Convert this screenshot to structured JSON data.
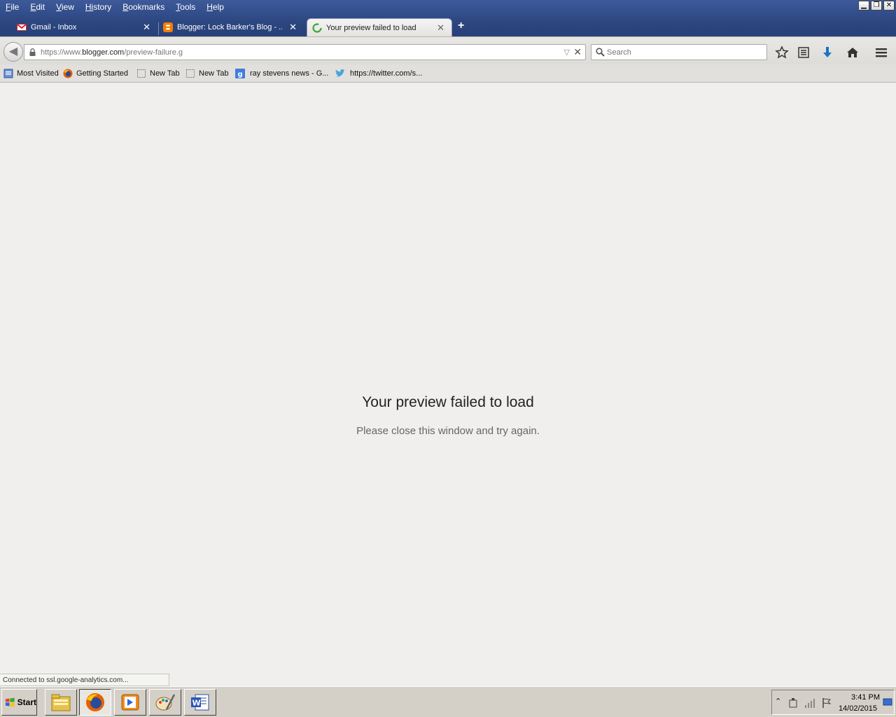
{
  "menu": {
    "items": [
      {
        "key": "F",
        "rest": "ile"
      },
      {
        "key": "E",
        "rest": "dit"
      },
      {
        "key": "V",
        "rest": "iew"
      },
      {
        "key": "Hi",
        "rest": "story",
        "underline_index": 1
      },
      {
        "key": "B",
        "rest": "ookmarks"
      },
      {
        "key": "T",
        "rest": "ools"
      },
      {
        "key": "H",
        "rest": "elp"
      }
    ]
  },
  "tabs": [
    {
      "label": "Gmail - Inbox",
      "icon": "gmail-icon"
    },
    {
      "label": "Blogger: Lock Barker's Blog - ...",
      "icon": "blogger-icon"
    },
    {
      "label": "Your preview failed to load",
      "icon": "loading-spinner-icon",
      "active": true
    }
  ],
  "tab_close_glyph": "✕",
  "new_tab_glyph": "+",
  "urlbar": {
    "prefix": "https://www.",
    "host": "blogger.com",
    "path": "/preview-failure.g"
  },
  "search": {
    "placeholder": "Search"
  },
  "bookmarks": [
    {
      "label": "Most Visited",
      "icon": "most-visited-icon"
    },
    {
      "label": "Getting Started",
      "icon": "firefox-icon"
    },
    {
      "label": "New Tab",
      "icon": "blank-page-icon"
    },
    {
      "label": "New Tab",
      "icon": "blank-page-icon"
    },
    {
      "label": "ray stevens news - G...",
      "icon": "google-icon"
    },
    {
      "label": "https://twitter.com/s...",
      "icon": "twitter-icon"
    }
  ],
  "content": {
    "title": "Your preview failed to load",
    "subtitle": "Please close this window and try again."
  },
  "status": "Connected to ssl.google-analytics.com...",
  "taskbar": {
    "start_label": "Start",
    "time": "3:41 PM",
    "date": "14/02/2015",
    "buttons": [
      "file-explorer-icon",
      "firefox-icon",
      "media-player-icon",
      "paint-icon",
      "word-icon"
    ]
  },
  "colors": {
    "titlebar": "#2c4680",
    "content_bg": "#f0efed",
    "accent_blue": "#1a73c4"
  }
}
